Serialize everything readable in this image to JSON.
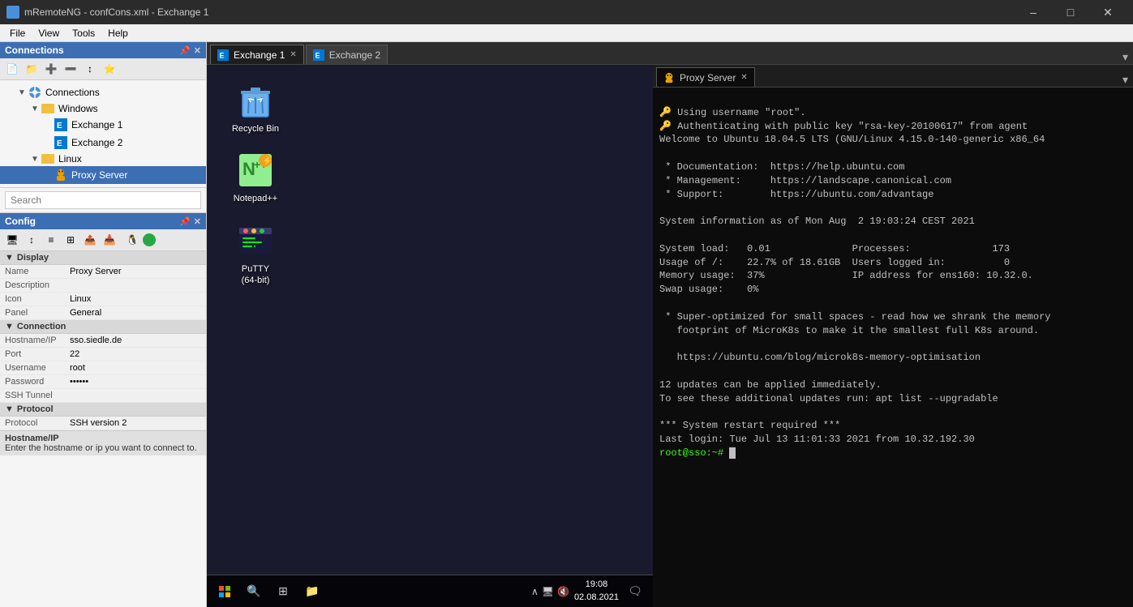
{
  "titleBar": {
    "appName": "mRemoteNG",
    "fileName": "confCons.xml",
    "activeConnection": "Exchange 1",
    "title": "mRemoteNG - confCons.xml - Exchange 1"
  },
  "menuBar": {
    "items": [
      "File",
      "View",
      "Tools",
      "Help"
    ]
  },
  "connectionsPanel": {
    "title": "Connections",
    "tree": [
      {
        "id": "connections-root",
        "label": "Connections",
        "type": "root",
        "indent": 0,
        "expanded": true
      },
      {
        "id": "windows-folder",
        "label": "Windows",
        "type": "folder",
        "indent": 1,
        "expanded": true
      },
      {
        "id": "exchange1",
        "label": "Exchange 1",
        "type": "exchange",
        "indent": 2
      },
      {
        "id": "exchange2",
        "label": "Exchange 2",
        "type": "exchange",
        "indent": 2
      },
      {
        "id": "linux-folder",
        "label": "Linux",
        "type": "folder",
        "indent": 1,
        "expanded": true
      },
      {
        "id": "proxy-server",
        "label": "Proxy Server",
        "type": "linux",
        "indent": 2,
        "selected": true
      }
    ]
  },
  "searchBox": {
    "placeholder": "Search"
  },
  "configPanel": {
    "title": "Config",
    "sections": [
      {
        "name": "Display",
        "rows": [
          {
            "label": "Name",
            "value": "Proxy Server"
          },
          {
            "label": "Description",
            "value": ""
          },
          {
            "label": "Icon",
            "value": "Linux"
          },
          {
            "label": "Panel",
            "value": "General"
          }
        ]
      },
      {
        "name": "Connection",
        "rows": [
          {
            "label": "Hostname/IP",
            "value": "sso.siedle.de"
          },
          {
            "label": "Port",
            "value": "22"
          },
          {
            "label": "Username",
            "value": "root"
          },
          {
            "label": "Password",
            "value": ""
          },
          {
            "label": "SSH Tunnel",
            "value": ""
          }
        ]
      },
      {
        "name": "Protocol",
        "rows": [
          {
            "label": "Protocol",
            "value": "SSH version 2"
          }
        ]
      }
    ]
  },
  "statusBar": {
    "label": "Hostname/IP",
    "hint": "Enter the hostname or ip you want to connect to."
  },
  "tabs": {
    "exchange1": {
      "label": "Exchange 1",
      "active": true
    },
    "exchange2": {
      "label": "Exchange 2",
      "active": false
    }
  },
  "terminalTab": {
    "label": "Proxy Server"
  },
  "desktop": {
    "icons": [
      {
        "id": "recycle-bin",
        "label": "Recycle Bin"
      },
      {
        "id": "notepadpp",
        "label": "Notepad++"
      },
      {
        "id": "putty",
        "label": "PuTTY\n(64-bit)"
      }
    ]
  },
  "taskbar": {
    "time": "19:08",
    "date": "02.08.2021"
  },
  "terminal": {
    "content": [
      "Using username \"root\".",
      "Authenticating with public key \"rsa-key-20100617\" from agent",
      "Welcome to Ubuntu 18.04.5 LTS (GNU/Linux 4.15.0-140-generic x86_64",
      "",
      " * Documentation:  https://help.ubuntu.com",
      " * Management:     https://landscape.canonical.com",
      " * Support:        https://ubuntu.com/advantage",
      "",
      "System information as of Mon Aug  2 19:03:24 CEST 2021",
      "",
      "System load:   0.01              Processes:              173",
      "Usage of /:    22.7% of 18.61GB  Users logged in:          0",
      "Memory usage:  37%               IP address for ens160: 10.32.0.",
      "Swap usage:    0%",
      "",
      " * Super-optimized for small spaces - read how we shrank the memory",
      "   footprint of MicroK8s to make it the smallest full K8s around.",
      "",
      "   https://ubuntu.com/blog/microk8s-memory-optimisation",
      "",
      "12 updates can be applied immediately.",
      "To see these additional updates run: apt list --upgradable",
      "",
      "*** System restart required ***",
      "Last login: Tue Jul 13 11:01:33 2021 from 10.32.192.30",
      "root@sso:~# "
    ]
  }
}
